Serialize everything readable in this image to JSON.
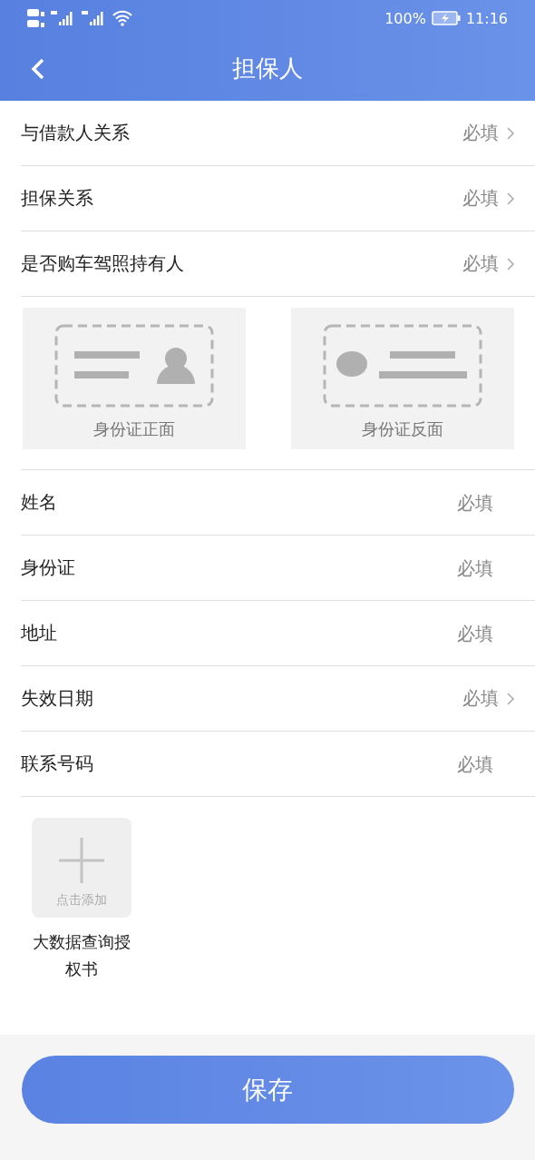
{
  "status_bar": {
    "battery": "100%",
    "time": "11:16"
  },
  "header": {
    "title": "担保人"
  },
  "rows_top": [
    {
      "label": "与借款人关系",
      "kind": "select",
      "placeholder": "必填"
    },
    {
      "label": "担保关系",
      "kind": "select",
      "placeholder": "必填"
    },
    {
      "label": "是否购车驾照持有人",
      "kind": "select",
      "placeholder": "必填"
    }
  ],
  "id_cards": [
    {
      "label": "身份证正面",
      "kind": "front"
    },
    {
      "label": "身份证反面",
      "kind": "back"
    }
  ],
  "rows_bottom": [
    {
      "label": "姓名",
      "kind": "input",
      "placeholder": "必填"
    },
    {
      "label": "身份证",
      "kind": "input",
      "placeholder": "必填"
    },
    {
      "label": "地址",
      "kind": "input",
      "placeholder": "必填"
    },
    {
      "label": "失效日期",
      "kind": "select",
      "placeholder": "必填"
    },
    {
      "label": "联系号码",
      "kind": "input",
      "placeholder": "必填"
    }
  ],
  "uploads": [
    {
      "hint": "点击添加",
      "label": "大数据查询授权书"
    }
  ],
  "save_button": {
    "label": "保存"
  }
}
